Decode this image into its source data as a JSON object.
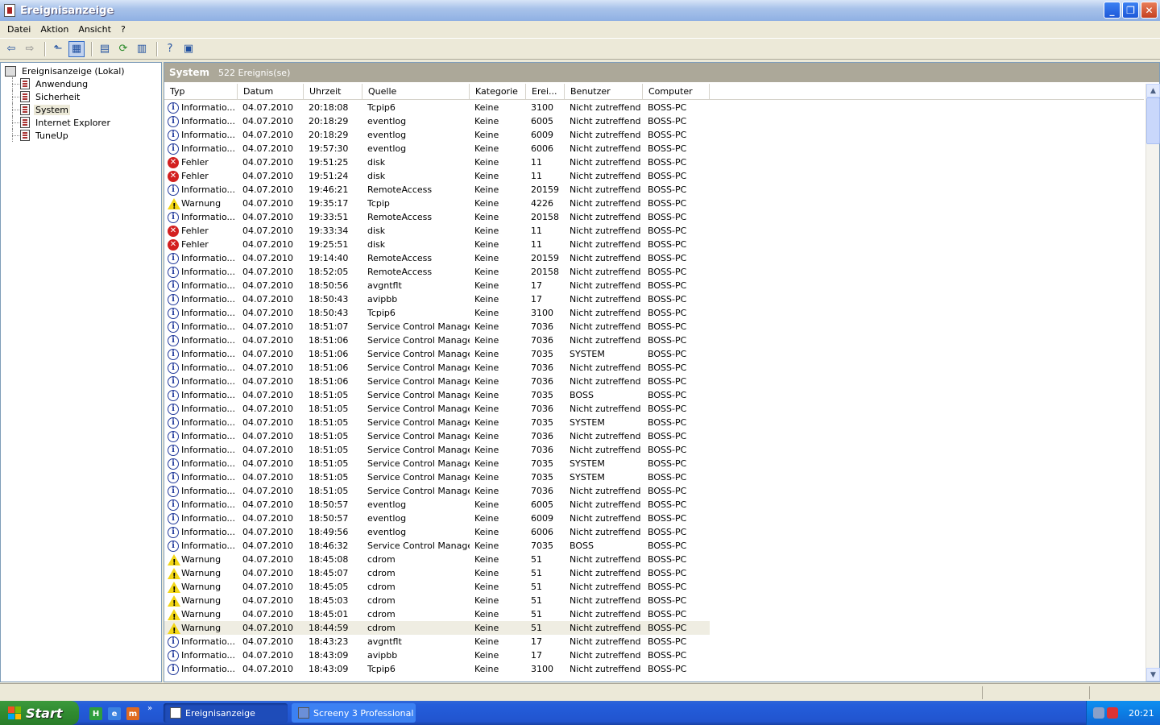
{
  "window": {
    "title": "Ereignisanzeige"
  },
  "menu": [
    "Datei",
    "Aktion",
    "Ansicht",
    "?"
  ],
  "tree": {
    "root": "Ereignisanzeige (Lokal)",
    "items": [
      "Anwendung",
      "Sicherheit",
      "System",
      "Internet Explorer",
      "TuneUp"
    ],
    "selected": "System"
  },
  "panel": {
    "title": "System",
    "count": "522 Ereignis(se)"
  },
  "columns": [
    "Typ",
    "Datum",
    "Uhrzeit",
    "Quelle",
    "Kategorie",
    "Erei...",
    "Benutzer",
    "Computer"
  ],
  "rows": [
    {
      "type": "info",
      "typ": "Informatio...",
      "datum": "04.07.2010",
      "zeit": "20:18:08",
      "quelle": "Tcpip6",
      "kat": "Keine",
      "id": "3100",
      "user": "Nicht zutreffend",
      "comp": "BOSS-PC"
    },
    {
      "type": "info",
      "typ": "Informatio...",
      "datum": "04.07.2010",
      "zeit": "20:18:29",
      "quelle": "eventlog",
      "kat": "Keine",
      "id": "6005",
      "user": "Nicht zutreffend",
      "comp": "BOSS-PC"
    },
    {
      "type": "info",
      "typ": "Informatio...",
      "datum": "04.07.2010",
      "zeit": "20:18:29",
      "quelle": "eventlog",
      "kat": "Keine",
      "id": "6009",
      "user": "Nicht zutreffend",
      "comp": "BOSS-PC"
    },
    {
      "type": "info",
      "typ": "Informatio...",
      "datum": "04.07.2010",
      "zeit": "19:57:30",
      "quelle": "eventlog",
      "kat": "Keine",
      "id": "6006",
      "user": "Nicht zutreffend",
      "comp": "BOSS-PC"
    },
    {
      "type": "error",
      "typ": "Fehler",
      "datum": "04.07.2010",
      "zeit": "19:51:25",
      "quelle": "disk",
      "kat": "Keine",
      "id": "11",
      "user": "Nicht zutreffend",
      "comp": "BOSS-PC"
    },
    {
      "type": "error",
      "typ": "Fehler",
      "datum": "04.07.2010",
      "zeit": "19:51:24",
      "quelle": "disk",
      "kat": "Keine",
      "id": "11",
      "user": "Nicht zutreffend",
      "comp": "BOSS-PC"
    },
    {
      "type": "info",
      "typ": "Informatio...",
      "datum": "04.07.2010",
      "zeit": "19:46:21",
      "quelle": "RemoteAccess",
      "kat": "Keine",
      "id": "20159",
      "user": "Nicht zutreffend",
      "comp": "BOSS-PC"
    },
    {
      "type": "warn",
      "typ": "Warnung",
      "datum": "04.07.2010",
      "zeit": "19:35:17",
      "quelle": "Tcpip",
      "kat": "Keine",
      "id": "4226",
      "user": "Nicht zutreffend",
      "comp": "BOSS-PC"
    },
    {
      "type": "info",
      "typ": "Informatio...",
      "datum": "04.07.2010",
      "zeit": "19:33:51",
      "quelle": "RemoteAccess",
      "kat": "Keine",
      "id": "20158",
      "user": "Nicht zutreffend",
      "comp": "BOSS-PC"
    },
    {
      "type": "error",
      "typ": "Fehler",
      "datum": "04.07.2010",
      "zeit": "19:33:34",
      "quelle": "disk",
      "kat": "Keine",
      "id": "11",
      "user": "Nicht zutreffend",
      "comp": "BOSS-PC"
    },
    {
      "type": "error",
      "typ": "Fehler",
      "datum": "04.07.2010",
      "zeit": "19:25:51",
      "quelle": "disk",
      "kat": "Keine",
      "id": "11",
      "user": "Nicht zutreffend",
      "comp": "BOSS-PC"
    },
    {
      "type": "info",
      "typ": "Informatio...",
      "datum": "04.07.2010",
      "zeit": "19:14:40",
      "quelle": "RemoteAccess",
      "kat": "Keine",
      "id": "20159",
      "user": "Nicht zutreffend",
      "comp": "BOSS-PC"
    },
    {
      "type": "info",
      "typ": "Informatio...",
      "datum": "04.07.2010",
      "zeit": "18:52:05",
      "quelle": "RemoteAccess",
      "kat": "Keine",
      "id": "20158",
      "user": "Nicht zutreffend",
      "comp": "BOSS-PC"
    },
    {
      "type": "info",
      "typ": "Informatio...",
      "datum": "04.07.2010",
      "zeit": "18:50:56",
      "quelle": "avgntflt",
      "kat": "Keine",
      "id": "17",
      "user": "Nicht zutreffend",
      "comp": "BOSS-PC"
    },
    {
      "type": "info",
      "typ": "Informatio...",
      "datum": "04.07.2010",
      "zeit": "18:50:43",
      "quelle": "avipbb",
      "kat": "Keine",
      "id": "17",
      "user": "Nicht zutreffend",
      "comp": "BOSS-PC"
    },
    {
      "type": "info",
      "typ": "Informatio...",
      "datum": "04.07.2010",
      "zeit": "18:50:43",
      "quelle": "Tcpip6",
      "kat": "Keine",
      "id": "3100",
      "user": "Nicht zutreffend",
      "comp": "BOSS-PC"
    },
    {
      "type": "info",
      "typ": "Informatio...",
      "datum": "04.07.2010",
      "zeit": "18:51:07",
      "quelle": "Service Control Manager",
      "kat": "Keine",
      "id": "7036",
      "user": "Nicht zutreffend",
      "comp": "BOSS-PC"
    },
    {
      "type": "info",
      "typ": "Informatio...",
      "datum": "04.07.2010",
      "zeit": "18:51:06",
      "quelle": "Service Control Manager",
      "kat": "Keine",
      "id": "7036",
      "user": "Nicht zutreffend",
      "comp": "BOSS-PC"
    },
    {
      "type": "info",
      "typ": "Informatio...",
      "datum": "04.07.2010",
      "zeit": "18:51:06",
      "quelle": "Service Control Manager",
      "kat": "Keine",
      "id": "7035",
      "user": "SYSTEM",
      "comp": "BOSS-PC"
    },
    {
      "type": "info",
      "typ": "Informatio...",
      "datum": "04.07.2010",
      "zeit": "18:51:06",
      "quelle": "Service Control Manager",
      "kat": "Keine",
      "id": "7036",
      "user": "Nicht zutreffend",
      "comp": "BOSS-PC"
    },
    {
      "type": "info",
      "typ": "Informatio...",
      "datum": "04.07.2010",
      "zeit": "18:51:06",
      "quelle": "Service Control Manager",
      "kat": "Keine",
      "id": "7036",
      "user": "Nicht zutreffend",
      "comp": "BOSS-PC"
    },
    {
      "type": "info",
      "typ": "Informatio...",
      "datum": "04.07.2010",
      "zeit": "18:51:05",
      "quelle": "Service Control Manager",
      "kat": "Keine",
      "id": "7035",
      "user": "BOSS",
      "comp": "BOSS-PC"
    },
    {
      "type": "info",
      "typ": "Informatio...",
      "datum": "04.07.2010",
      "zeit": "18:51:05",
      "quelle": "Service Control Manager",
      "kat": "Keine",
      "id": "7036",
      "user": "Nicht zutreffend",
      "comp": "BOSS-PC"
    },
    {
      "type": "info",
      "typ": "Informatio...",
      "datum": "04.07.2010",
      "zeit": "18:51:05",
      "quelle": "Service Control Manager",
      "kat": "Keine",
      "id": "7035",
      "user": "SYSTEM",
      "comp": "BOSS-PC"
    },
    {
      "type": "info",
      "typ": "Informatio...",
      "datum": "04.07.2010",
      "zeit": "18:51:05",
      "quelle": "Service Control Manager",
      "kat": "Keine",
      "id": "7036",
      "user": "Nicht zutreffend",
      "comp": "BOSS-PC"
    },
    {
      "type": "info",
      "typ": "Informatio...",
      "datum": "04.07.2010",
      "zeit": "18:51:05",
      "quelle": "Service Control Manager",
      "kat": "Keine",
      "id": "7036",
      "user": "Nicht zutreffend",
      "comp": "BOSS-PC"
    },
    {
      "type": "info",
      "typ": "Informatio...",
      "datum": "04.07.2010",
      "zeit": "18:51:05",
      "quelle": "Service Control Manager",
      "kat": "Keine",
      "id": "7035",
      "user": "SYSTEM",
      "comp": "BOSS-PC"
    },
    {
      "type": "info",
      "typ": "Informatio...",
      "datum": "04.07.2010",
      "zeit": "18:51:05",
      "quelle": "Service Control Manager",
      "kat": "Keine",
      "id": "7035",
      "user": "SYSTEM",
      "comp": "BOSS-PC"
    },
    {
      "type": "info",
      "typ": "Informatio...",
      "datum": "04.07.2010",
      "zeit": "18:51:05",
      "quelle": "Service Control Manager",
      "kat": "Keine",
      "id": "7036",
      "user": "Nicht zutreffend",
      "comp": "BOSS-PC"
    },
    {
      "type": "info",
      "typ": "Informatio...",
      "datum": "04.07.2010",
      "zeit": "18:50:57",
      "quelle": "eventlog",
      "kat": "Keine",
      "id": "6005",
      "user": "Nicht zutreffend",
      "comp": "BOSS-PC"
    },
    {
      "type": "info",
      "typ": "Informatio...",
      "datum": "04.07.2010",
      "zeit": "18:50:57",
      "quelle": "eventlog",
      "kat": "Keine",
      "id": "6009",
      "user": "Nicht zutreffend",
      "comp": "BOSS-PC"
    },
    {
      "type": "info",
      "typ": "Informatio...",
      "datum": "04.07.2010",
      "zeit": "18:49:56",
      "quelle": "eventlog",
      "kat": "Keine",
      "id": "6006",
      "user": "Nicht zutreffend",
      "comp": "BOSS-PC"
    },
    {
      "type": "info",
      "typ": "Informatio...",
      "datum": "04.07.2010",
      "zeit": "18:46:32",
      "quelle": "Service Control Manager",
      "kat": "Keine",
      "id": "7035",
      "user": "BOSS",
      "comp": "BOSS-PC"
    },
    {
      "type": "warn",
      "typ": "Warnung",
      "datum": "04.07.2010",
      "zeit": "18:45:08",
      "quelle": "cdrom",
      "kat": "Keine",
      "id": "51",
      "user": "Nicht zutreffend",
      "comp": "BOSS-PC"
    },
    {
      "type": "warn",
      "typ": "Warnung",
      "datum": "04.07.2010",
      "zeit": "18:45:07",
      "quelle": "cdrom",
      "kat": "Keine",
      "id": "51",
      "user": "Nicht zutreffend",
      "comp": "BOSS-PC"
    },
    {
      "type": "warn",
      "typ": "Warnung",
      "datum": "04.07.2010",
      "zeit": "18:45:05",
      "quelle": "cdrom",
      "kat": "Keine",
      "id": "51",
      "user": "Nicht zutreffend",
      "comp": "BOSS-PC"
    },
    {
      "type": "warn",
      "typ": "Warnung",
      "datum": "04.07.2010",
      "zeit": "18:45:03",
      "quelle": "cdrom",
      "kat": "Keine",
      "id": "51",
      "user": "Nicht zutreffend",
      "comp": "BOSS-PC"
    },
    {
      "type": "warn",
      "typ": "Warnung",
      "datum": "04.07.2010",
      "zeit": "18:45:01",
      "quelle": "cdrom",
      "kat": "Keine",
      "id": "51",
      "user": "Nicht zutreffend",
      "comp": "BOSS-PC"
    },
    {
      "type": "warn",
      "typ": "Warnung",
      "datum": "04.07.2010",
      "zeit": "18:44:59",
      "quelle": "cdrom",
      "kat": "Keine",
      "id": "51",
      "user": "Nicht zutreffend",
      "comp": "BOSS-PC",
      "highlight": true
    },
    {
      "type": "info",
      "typ": "Informatio...",
      "datum": "04.07.2010",
      "zeit": "18:43:23",
      "quelle": "avgntflt",
      "kat": "Keine",
      "id": "17",
      "user": "Nicht zutreffend",
      "comp": "BOSS-PC"
    },
    {
      "type": "info",
      "typ": "Informatio...",
      "datum": "04.07.2010",
      "zeit": "18:43:09",
      "quelle": "avipbb",
      "kat": "Keine",
      "id": "17",
      "user": "Nicht zutreffend",
      "comp": "BOSS-PC"
    },
    {
      "type": "info",
      "typ": "Informatio...",
      "datum": "04.07.2010",
      "zeit": "18:43:09",
      "quelle": "Tcpip6",
      "kat": "Keine",
      "id": "3100",
      "user": "Nicht zutreffend",
      "comp": "BOSS-PC"
    }
  ],
  "taskbar": {
    "start": "Start",
    "tasks": [
      "Ereignisanzeige",
      "Screeny 3 Professional"
    ],
    "clock": "20:21",
    "quicklaunch": [
      "H",
      "e",
      "m"
    ],
    "more": "»"
  },
  "colors": {
    "header_bar": "#aca899",
    "taskbar": "#245edb",
    "start": "#308b30"
  }
}
